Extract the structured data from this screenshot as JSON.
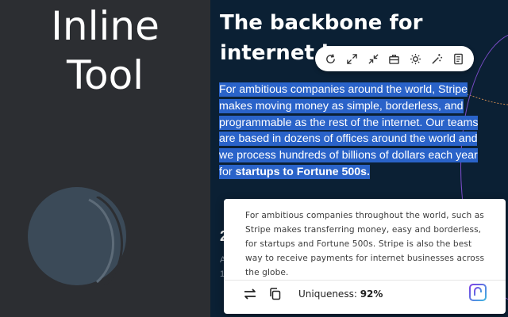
{
  "promo": {
    "title_line1": "Inline",
    "title_line2": "Tool"
  },
  "page": {
    "headline_line1": "The backbone for",
    "headline_line2": "internet bu",
    "paragraph_plain": "For ambitious companies around the world, Stripe makes moving money as simple, borderless, and programmable as the rest of the internet. Our teams are based in dozens of offices around the world and we process hundreds of billions of dollars each year for ",
    "paragraph_bold": "startups to Fortune 500s.",
    "section_heading": "2",
    "section_sub1": "A",
    "section_sub2": "1"
  },
  "toolbar": {
    "buttons": [
      {
        "icon": "refresh-icon",
        "label": "Rephrase"
      },
      {
        "icon": "expand-icon",
        "label": "Expand"
      },
      {
        "icon": "shorten-icon",
        "label": "Shorten"
      },
      {
        "icon": "briefcase-icon",
        "label": "Formal"
      },
      {
        "icon": "sun-icon",
        "label": "Simplify"
      },
      {
        "icon": "magic-wand-icon",
        "label": "Improve"
      },
      {
        "icon": "document-icon",
        "label": "Summarize"
      }
    ]
  },
  "result": {
    "text": "For ambitious companies throughout the world, such as Stripe makes transferring money, easy and borderless, for startups and Fortune 500s. Stripe is also the best way to receive payments for internet businesses across the globe.",
    "uniqueness_label": "Uniqueness:",
    "uniqueness_value": "92%"
  },
  "colors": {
    "selection": "#2a63c9",
    "background_dark": "#0b2034",
    "accent_purple": "#7b4cc9"
  }
}
